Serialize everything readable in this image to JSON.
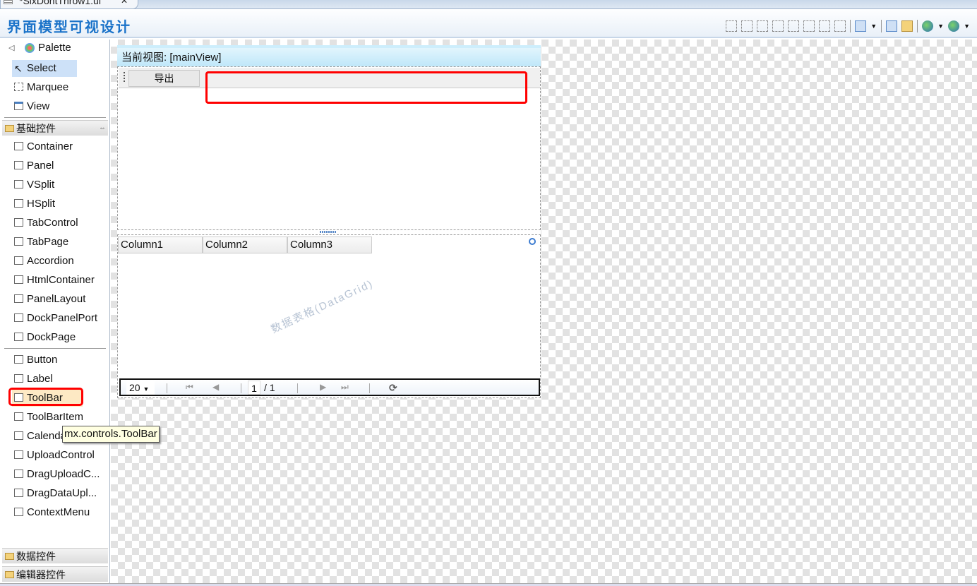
{
  "tab": {
    "title": "*SixDontThrow1.ui",
    "close": "✕"
  },
  "header": {
    "title": "界面模型可视设计"
  },
  "toolbar_icons": [
    "align-left-icon",
    "align-center-icon",
    "align-right-icon",
    "align-top-icon",
    "align-middle-icon",
    "align-bottom-icon",
    "same-width-icon",
    "same-height-icon",
    "layers-icon",
    "copy-icon",
    "paste-icon",
    "globe-icon",
    "globe2-icon"
  ],
  "palette": {
    "title": "Palette",
    "tools": [
      {
        "label": "Select"
      },
      {
        "label": "Marquee"
      },
      {
        "label": "View"
      }
    ],
    "group_basic": "基础控件",
    "basic": [
      {
        "label": "Container"
      },
      {
        "label": "Panel"
      },
      {
        "label": "VSplit"
      },
      {
        "label": "HSplit"
      },
      {
        "label": "TabControl"
      },
      {
        "label": "TabPage"
      },
      {
        "label": "Accordion"
      },
      {
        "label": "HtmlContainer"
      },
      {
        "label": "PanelLayout"
      },
      {
        "label": "DockPanelPort"
      },
      {
        "label": "DockPage"
      }
    ],
    "controls": [
      {
        "label": "Button"
      },
      {
        "label": "Label"
      },
      {
        "label": "ToolBar"
      },
      {
        "label": "ToolBarItem"
      },
      {
        "label": "Calendar"
      },
      {
        "label": "UploadControl"
      },
      {
        "label": "DragUploadC..."
      },
      {
        "label": "DragDataUpl..."
      },
      {
        "label": "ContextMenu"
      }
    ],
    "group_data": "数据控件",
    "group_editor": "编辑器控件",
    "tooltip": "mx.controls.ToolBar"
  },
  "view": {
    "header": "当前视图: [mainView]",
    "export_button": "导出",
    "grid": {
      "columns": [
        "Column1",
        "Column2",
        "Column3"
      ],
      "watermark": "数据表格(DataGrid)"
    },
    "pager": {
      "page_size": "20",
      "page": "1",
      "total": "/ 1"
    }
  },
  "colors": {
    "highlight": "#ff0000",
    "accent": "#1b73c9"
  }
}
